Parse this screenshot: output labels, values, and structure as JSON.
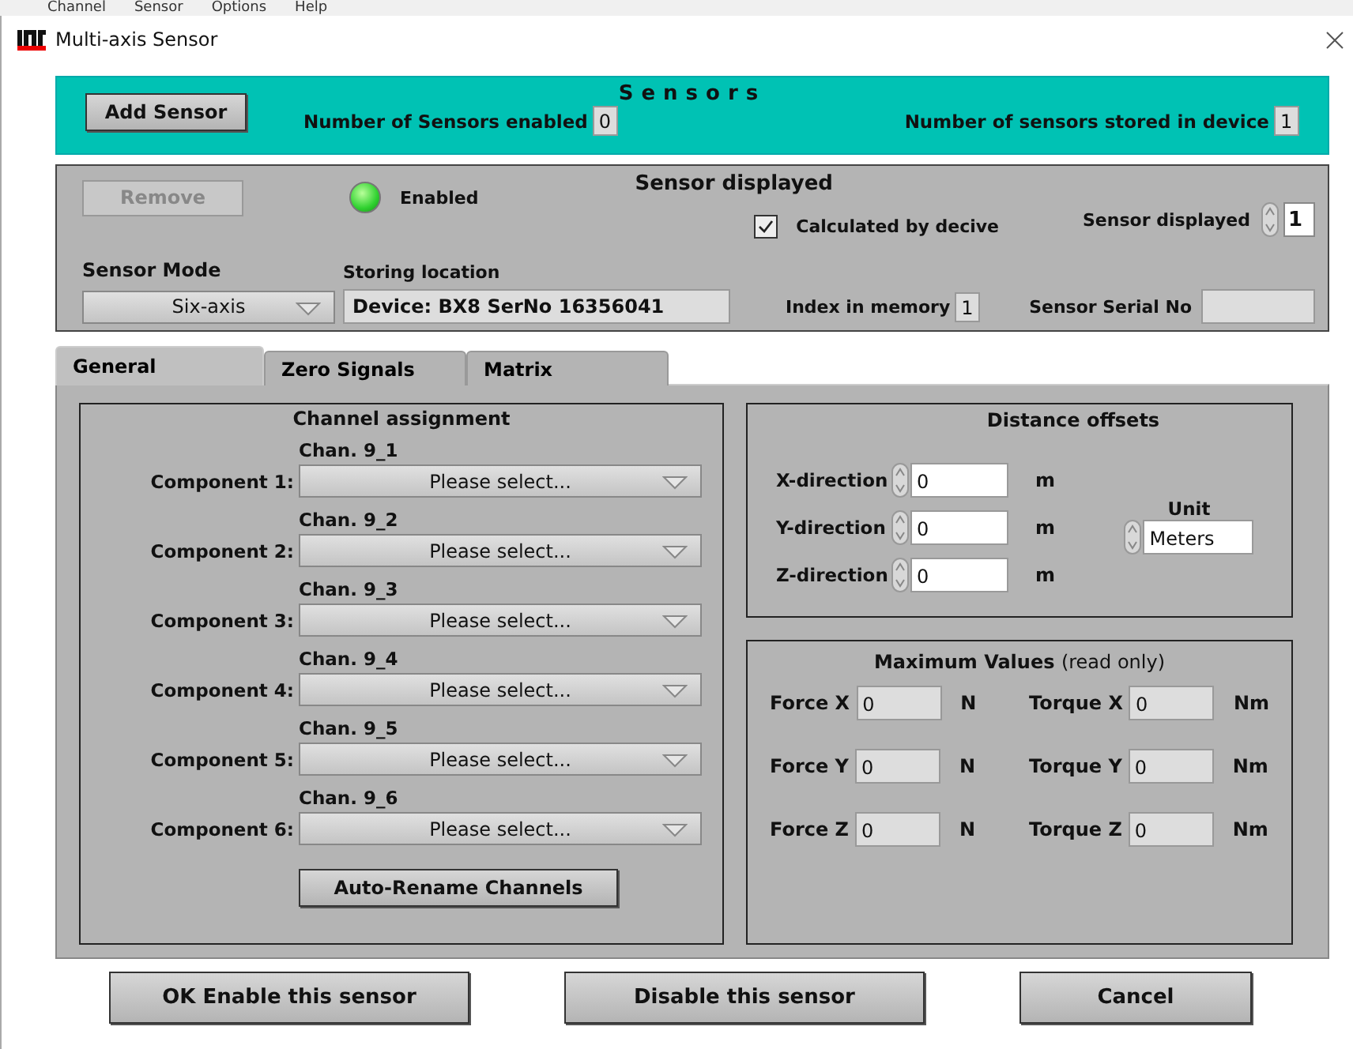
{
  "background_menu": [
    "Channel",
    "Sensor",
    "Options",
    "Help"
  ],
  "window": {
    "title": "Multi-axis Sensor"
  },
  "sensors_panel": {
    "title": "Sensors",
    "add_button": "Add Sensor",
    "enabled_label": "Number of Sensors enabled",
    "enabled_value": "0",
    "stored_label": "Number of sensors stored in device",
    "stored_value": "1"
  },
  "sensor_displayed_panel": {
    "title": "Sensor displayed",
    "remove_button": {
      "label": "Remove",
      "disabled": true
    },
    "indicator": {
      "label": "Enabled",
      "on": true
    },
    "calculated": {
      "label": "Calculated by decive",
      "checked": true
    },
    "sensor_displayed": {
      "label": "Sensor displayed",
      "value": "1"
    },
    "sensor_mode": {
      "label": "Sensor Mode",
      "value": "Six-axis"
    },
    "storing_location": {
      "label": "Storing location",
      "value": "Device: BX8 SerNo 16356041"
    },
    "index": {
      "label": "Index in memory",
      "value": "1"
    },
    "serial": {
      "label": "Sensor Serial No"
    }
  },
  "tabs": [
    {
      "label": "General",
      "selected": true
    },
    {
      "label": "Zero Signals",
      "selected": false
    },
    {
      "label": "Matrix",
      "selected": false
    }
  ],
  "channel_assignment": {
    "title": "Channel assignment",
    "components": [
      {
        "channel": "Chan. 9_1",
        "label": "Component 1:",
        "value": "Please select..."
      },
      {
        "channel": "Chan. 9_2",
        "label": "Component 2:",
        "value": "Please select..."
      },
      {
        "channel": "Chan. 9_3",
        "label": "Component 3:",
        "value": "Please select..."
      },
      {
        "channel": "Chan. 9_4",
        "label": "Component 4:",
        "value": "Please select..."
      },
      {
        "channel": "Chan. 9_5",
        "label": "Component 5:",
        "value": "Please select..."
      },
      {
        "channel": "Chan. 9_6",
        "label": "Component 6:",
        "value": "Please select..."
      }
    ],
    "rename_button": "Auto-Rename Channels"
  },
  "distance_offsets": {
    "title": "Distance offsets",
    "rows": [
      {
        "label": "X-direction",
        "value": "0",
        "unit": "m"
      },
      {
        "label": "Y-direction",
        "value": "0",
        "unit": "m"
      },
      {
        "label": "Z-direction",
        "value": "0",
        "unit": "m"
      }
    ],
    "unit_label": "Unit",
    "unit_value": "Meters"
  },
  "maximum_values": {
    "title": "Maximum Values",
    "note": "(read only)",
    "items": [
      {
        "label": "Force X",
        "value": "0",
        "unit": "N"
      },
      {
        "label": "Torque X",
        "value": "0",
        "unit": "Nm"
      },
      {
        "label": "Force Y",
        "value": "0",
        "unit": "N"
      },
      {
        "label": "Torque Y",
        "value": "0",
        "unit": "Nm"
      },
      {
        "label": "Force Z",
        "value": "0",
        "unit": "N"
      },
      {
        "label": "Torque Z",
        "value": "0",
        "unit": "Nm"
      }
    ]
  },
  "buttons": [
    "OK Enable this sensor",
    "Disable this sensor",
    "Cancel"
  ]
}
